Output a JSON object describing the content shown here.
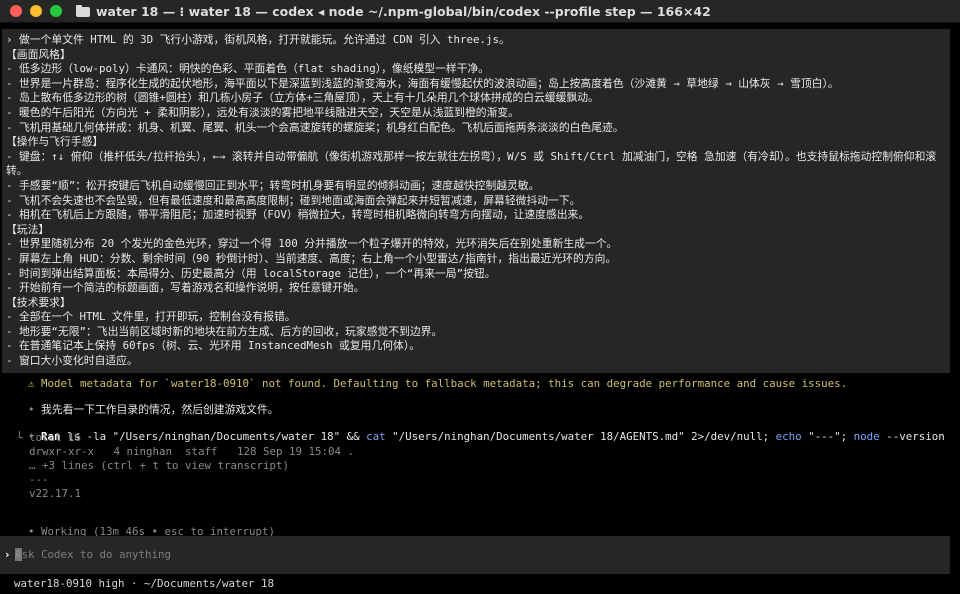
{
  "window": {
    "title": "water 18 — ⁝ water 18 — codex ◂ node ~/.npm-global/bin/codex --profile step — 166×42",
    "traffic_lights": {
      "close": "#ff5f57",
      "minimize": "#febc2e",
      "zoom": "#28c840"
    }
  },
  "prompt_block": {
    "caret": "›",
    "lines": [
      "做一个单文件 HTML 的 3D 飞行小游戏，街机风格，打开就能玩。允许通过 CDN 引入 three.js。",
      "【画面风格】",
      "- 低多边形（low-poly）卡通风：明快的色彩、平面着色（flat shading），像纸模型一样干净。",
      "- 世界是一片群岛：程序化生成的起伏地形，海平面以下是深蓝到浅蓝的渐变海水，海面有缓慢起伏的波浪动画；岛上按高度着色（沙滩黄 → 草地绿 → 山体灰 → 雪顶白）。",
      "- 岛上散布低多边形的树（圆锥+圆柱）和几栋小房子（立方体+三角屋顶），天上有十几朵用几个球体拼成的白云缓缓飘动。",
      "- 暖色的午后阳光（方向光 + 柔和阴影），远处有淡淡的雾把地平线融进天空，天空是从浅蓝到橙的渐变。",
      "- 飞机用基础几何体拼成：机身、机翼、尾翼、机头一个会高速旋转的螺旋桨；机身红白配色。飞机后面拖两条淡淡的白色尾迹。",
      "【操作与飞行手感】",
      "- 键盘：↑↓ 俯仰（推杆低头/拉杆抬头），←→ 滚转并自动带偏航（像街机游戏那样一按左就往左拐弯），W/S 或 Shift/Ctrl 加减油门，空格 急加速（有冷却）。也支持鼠标拖动控制俯仰和滚转。",
      "- 手感要“顺”：松开按键后飞机自动缓慢回正到水平；转弯时机身要有明显的倾斜动画；速度越快控制越灵敏。",
      "- 飞机不会失速也不会坠毁，但有最低速度和最高高度限制；碰到地面或海面会弹起来并短暂减速，屏幕轻微抖动一下。",
      "- 相机在飞机后上方跟随，带平滑阻尼；加速时视野（FOV）稍微拉大，转弯时相机略微向转弯方向摆动，让速度感出来。",
      "【玩法】",
      "- 世界里随机分布 20 个发光的金色光环，穿过一个得 100 分并播放一个粒子爆开的特效，光环消失后在别处重新生成一个。",
      "- 屏幕左上角 HUD：分数、剩余时间（90 秒倒计时）、当前速度、高度；右上角一个小型雷达/指南针，指出最近光环的方向。",
      "- 时间到弹出结算面板：本局得分、历史最高分（用 localStorage 记住），一个“再来一局”按钮。",
      "- 开始前有一个简洁的标题画面，写着游戏名和操作说明，按任意键开始。",
      "【技术要求】",
      "- 全部在一个 HTML 文件里，打开即玩，控制台没有报错。",
      "- 地形要“无限”：飞出当前区域时新的地块在前方生成、后方的回收，玩家感觉不到边界。",
      "- 在普通笔记本上保持 60fps（树、云、光环用 InstancedMesh 或复用几何体）。",
      "- 窗口大小变化时自适应。"
    ]
  },
  "messages": {
    "warning_bullet": "⚠",
    "warning": "Model metadata for `water18-0910` not found. Defaulting to fallback metadata; this can degrade performance and cause issues.",
    "agent_bullet": "•",
    "agent_text": "我先看一下工作目录的情况，然后创建游戏文件。",
    "run_bullet": "•",
    "run_label": "Ran",
    "run_command_a": "ls -la \"/Users/ninghan/Documents/water 18\" && ",
    "run_command_cat": "cat",
    "run_command_b": " \"/Users/ninghan/Documents/water 18/AGENTS.md\" 2>/dev/null; ",
    "run_command_echo": "echo",
    "run_command_c": " \"---\"; ",
    "run_command_node": "node",
    "run_command_d": " --version",
    "output": [
      "└ total 16",
      "  drwxr-xr-x   4 ninghan  staff   128 Sep 19 15:04 .",
      "  … +3 lines (ctrl + t to view transcript)",
      "  ---",
      "  v22.17.1"
    ],
    "working_bullet": "•",
    "working": "Working (13m 46s • esc to interrupt)"
  },
  "input": {
    "caret": "›",
    "placeholder": "Ask Codex to do anything"
  },
  "status_bar": {
    "text": "water18-0910 high · ~/Documents/water 18"
  }
}
